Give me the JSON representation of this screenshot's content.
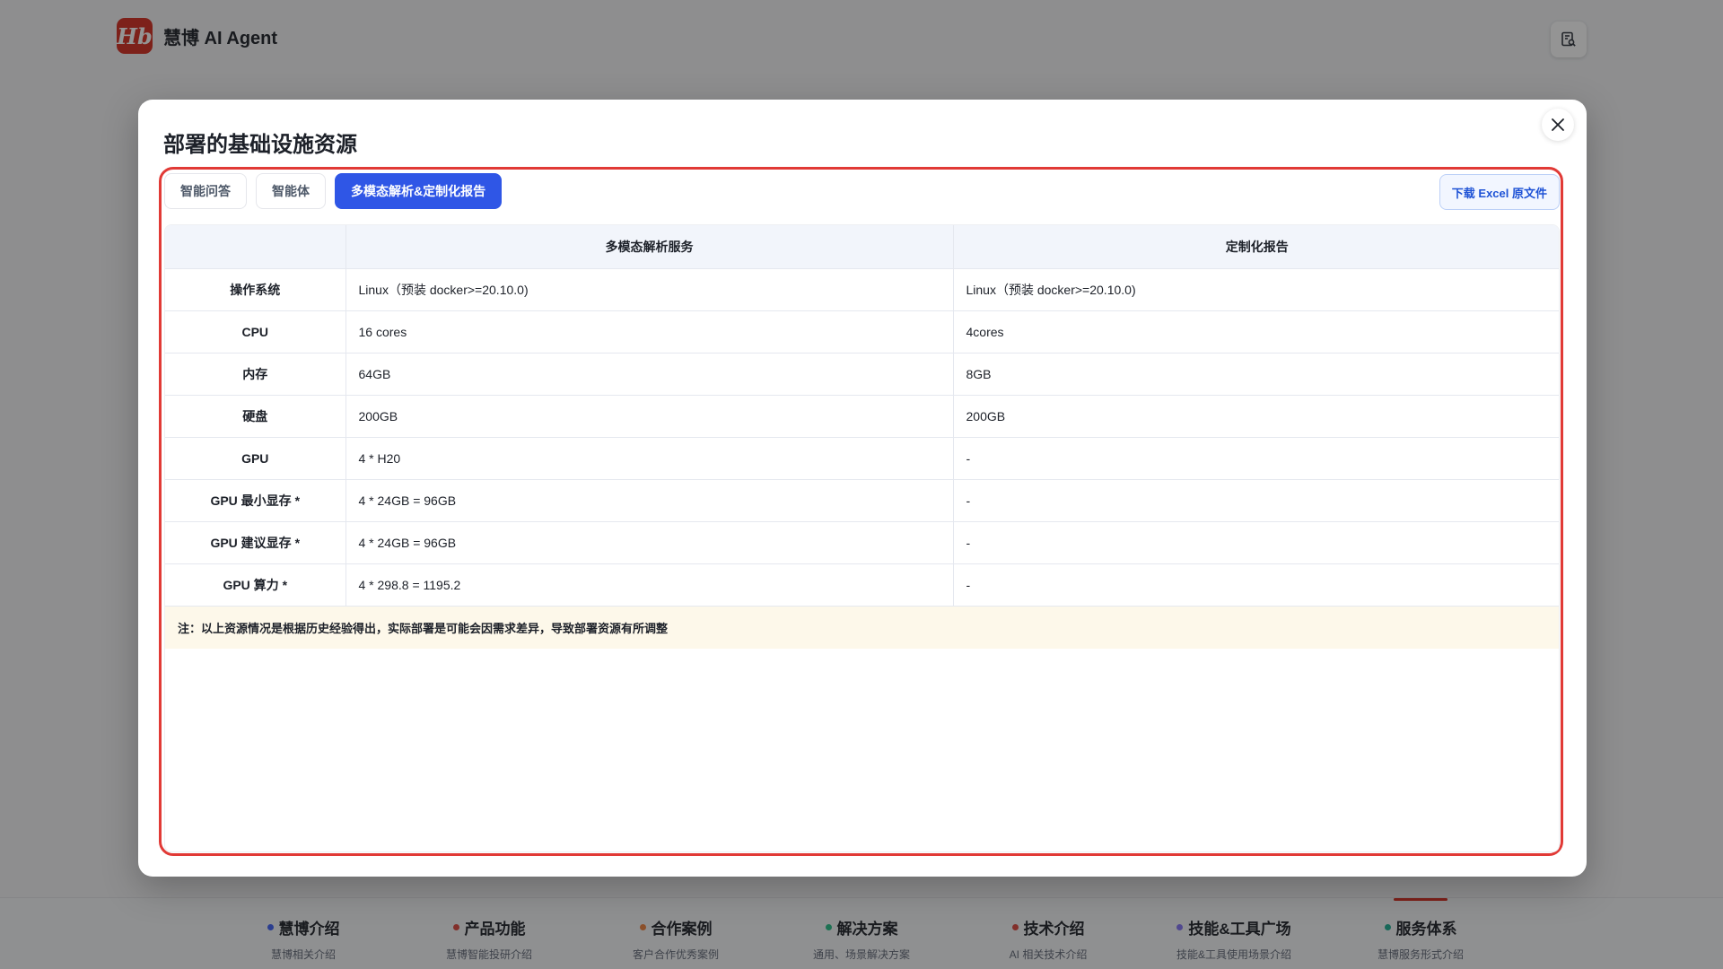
{
  "app": {
    "logo_text": "Hb",
    "name": "慧博 AI Agent"
  },
  "bottom_nav": [
    {
      "title": "慧博介绍",
      "subtitle": "慧博相关介绍",
      "dot_color": "#4a6cf7"
    },
    {
      "title": "产品功能",
      "subtitle": "慧博智能投研介绍",
      "dot_color": "#e0544a"
    },
    {
      "title": "合作案例",
      "subtitle": "客户合作优秀案例",
      "dot_color": "#f08a4b"
    },
    {
      "title": "解决方案",
      "subtitle": "通用、场景解决方案",
      "dot_color": "#34c38f"
    },
    {
      "title": "技术介绍",
      "subtitle": "AI 相关技术介绍",
      "dot_color": "#e0544a"
    },
    {
      "title": "技能&工具广场",
      "subtitle": "技能&工具使用场景介绍",
      "dot_color": "#8b7cf6"
    },
    {
      "title": "服务体系",
      "subtitle": "慧博服务形式介绍",
      "dot_color": "#2bb39a"
    }
  ],
  "modal": {
    "title": "部署的基础设施资源",
    "tabs": [
      {
        "label": "智能问答",
        "active": false
      },
      {
        "label": "智能体",
        "active": false
      },
      {
        "label": "多模态解析&定制化报告",
        "active": true
      }
    ],
    "download_label": "下载 Excel 原文件",
    "table": {
      "headers": [
        "",
        "多模态解析服务",
        "定制化报告"
      ],
      "rows": [
        [
          "操作系统",
          "Linux（预装 docker>=20.10.0)",
          "Linux（预装 docker>=20.10.0)"
        ],
        [
          "CPU",
          "16 cores",
          "4cores"
        ],
        [
          "内存",
          "64GB",
          "8GB"
        ],
        [
          "硬盘",
          "200GB",
          "200GB"
        ],
        [
          "GPU",
          "4 * H20",
          "-"
        ],
        [
          "GPU 最小显存 *",
          "4 * 24GB = 96GB",
          "-"
        ],
        [
          "GPU 建议显存 *",
          "4 * 24GB = 96GB",
          "-"
        ],
        [
          "GPU 算力 *",
          "4 * 298.8 = 1195.2",
          "-"
        ]
      ],
      "note": "注：以上资源情况是根据历史经验得出，实际部署是可能会因需求差异，导致部署资源有所调整"
    }
  }
}
